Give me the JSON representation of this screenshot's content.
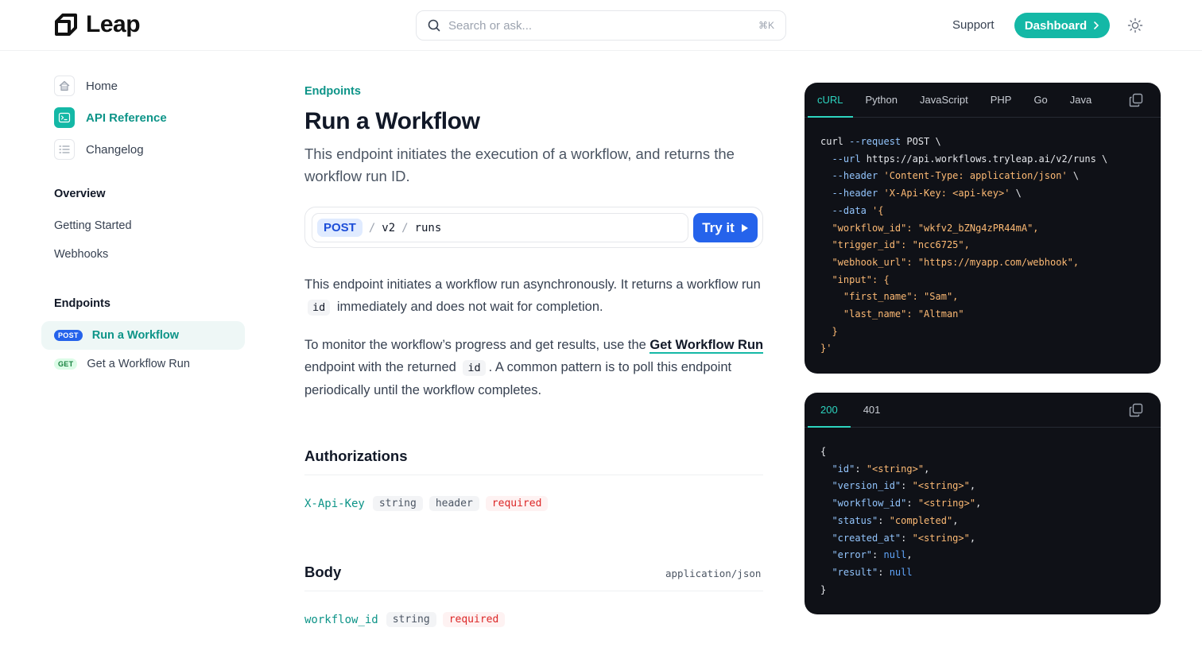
{
  "header": {
    "logo_text": "Leap",
    "search_placeholder": "Search or ask...",
    "search_shortcut": "⌘K",
    "support_label": "Support",
    "dashboard_label": "Dashboard"
  },
  "sidebar": {
    "top_links": [
      {
        "label": "Home",
        "icon": "home-icon"
      },
      {
        "label": "API Reference",
        "icon": "terminal-icon",
        "active": true
      },
      {
        "label": "Changelog",
        "icon": "list-icon"
      }
    ],
    "overview_heading": "Overview",
    "overview_items": [
      "Getting Started",
      "Webhooks"
    ],
    "endpoints_heading": "Endpoints",
    "endpoint_items": [
      {
        "method": "POST",
        "label": "Run a Workflow",
        "active": true
      },
      {
        "method": "GET",
        "label": "Get a Workflow Run"
      }
    ]
  },
  "main": {
    "eyebrow": "Endpoints",
    "title": "Run a Workflow",
    "subtitle": "This endpoint initiates the execution of a workflow, and returns the workflow run ID.",
    "endpoint": {
      "method": "POST",
      "path": [
        "v2",
        "runs"
      ],
      "try_label": "Try it"
    },
    "para1_a": "This endpoint initiates a workflow run asynchronously. It returns a workflow run",
    "para1_code": "id",
    "para1_b": "immediately and does not wait for completion.",
    "para2_a": "To monitor the workflow’s progress and get results, use the",
    "para2_link": "Get Workflow Run",
    "para2_b": "endpoint with the returned",
    "para2_code": "id",
    "para2_c": ". A common pattern is to poll this endpoint periodically until the workflow completes.",
    "auth_title": "Authorizations",
    "auth_field": {
      "name": "X-Api-Key",
      "type": "string",
      "location": "header",
      "required": "required"
    },
    "body_title": "Body",
    "body_content_type": "application/json",
    "body_field": {
      "name": "workflow_id",
      "type": "string",
      "required": "required"
    }
  },
  "request_panel": {
    "tabs": [
      "cURL",
      "Python",
      "JavaScript",
      "PHP",
      "Go",
      "Java"
    ],
    "active_tab": "cURL"
  },
  "response_panel": {
    "tabs": [
      "200",
      "401"
    ],
    "active_tab": "200"
  },
  "colors": {
    "accent": "#14b8a6",
    "post_blue": "#2563eb",
    "code_bg": "#0f1117"
  }
}
